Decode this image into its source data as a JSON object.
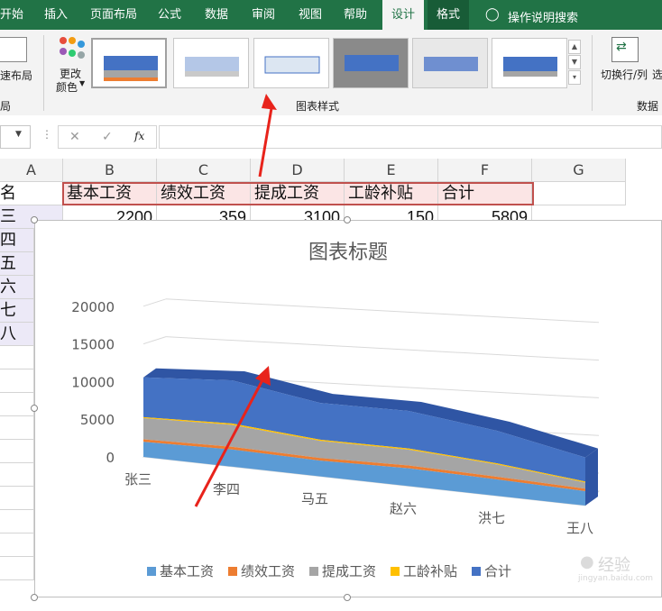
{
  "ribbon_tabs": [
    {
      "label": "开始",
      "x": -4,
      "w": 34
    },
    {
      "label": "插入",
      "x": 42,
      "w": 40
    },
    {
      "label": "页面布局",
      "x": 94,
      "w": 64
    },
    {
      "label": "公式",
      "x": 168,
      "w": 40
    },
    {
      "label": "数据",
      "x": 220,
      "w": 40
    },
    {
      "label": "审阅",
      "x": 272,
      "w": 40
    },
    {
      "label": "视图",
      "x": 324,
      "w": 40
    },
    {
      "label": "帮助",
      "x": 374,
      "w": 40
    },
    {
      "label": "设计",
      "x": 424,
      "w": 46,
      "active": true
    },
    {
      "label": "格式",
      "x": 474,
      "w": 46,
      "fmt": true
    }
  ],
  "tell_me": "操作说明搜索",
  "ribbon": {
    "quick_layout": "速布局",
    "layout_group": "局",
    "change_colors_1": "更改",
    "change_colors_2": "颜色",
    "styles_group": "图表样式",
    "switch_row_col": "切换行/列",
    "select_cut": "选",
    "data_group": "数据"
  },
  "formula": {
    "cancel": "✕",
    "enter": "✓",
    "fx": "fx"
  },
  "columns": [
    {
      "label": "A",
      "x": 0,
      "w": 70
    },
    {
      "label": "B",
      "x": 70,
      "w": 104
    },
    {
      "label": "C",
      "x": 174,
      "w": 104
    },
    {
      "label": "D",
      "x": 278,
      "w": 104
    },
    {
      "label": "E",
      "x": 382,
      "w": 104
    },
    {
      "label": "F",
      "x": 486,
      "w": 104
    },
    {
      "label": "G",
      "x": 590,
      "w": 104
    }
  ],
  "header_row": [
    "名",
    "基本工资",
    "绩效工资",
    "提成工资",
    "工龄补贴",
    "合计"
  ],
  "first_row": {
    "name": "三",
    "values": [
      "2200",
      "359",
      "3100",
      "150",
      "5809"
    ]
  },
  "side_names": [
    "四",
    "五",
    "六",
    "七",
    "八"
  ],
  "chart_data": {
    "type": "area",
    "title": "图表标题",
    "categories": [
      "张三",
      "李四",
      "马五",
      "赵六",
      "洪七",
      "王八"
    ],
    "ylim": [
      0,
      20000
    ],
    "yticks": [
      "20000",
      "15000",
      "10000",
      "5000",
      "0"
    ],
    "stacked": true,
    "series": [
      {
        "name": "基本工资",
        "color": "#5b9bd5",
        "values": [
          2200,
          2500,
          2300,
          2600,
          2400,
          2100
        ]
      },
      {
        "name": "绩效工资",
        "color": "#ed7d31",
        "values": [
          359,
          400,
          380,
          420,
          390,
          360
        ]
      },
      {
        "name": "提成工资",
        "color": "#a5a5a5",
        "values": [
          3100,
          3200,
          2500,
          2300,
          1800,
          900
        ]
      },
      {
        "name": "工龄补贴",
        "color": "#ffc000",
        "values": [
          150,
          200,
          180,
          170,
          160,
          150
        ]
      },
      {
        "name": "合计",
        "color": "#4472c4",
        "values": [
          5809,
          6300,
          5360,
          5490,
          4750,
          3510
        ]
      }
    ]
  },
  "watermark": {
    "brand": "经验",
    "site": "jingyan.baidu.com"
  }
}
